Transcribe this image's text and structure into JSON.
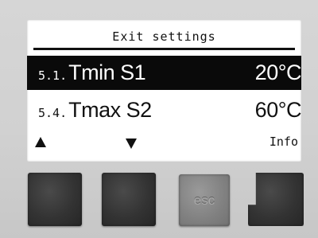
{
  "screen": {
    "title": "Exit settings",
    "rows": [
      {
        "index": "5.1.",
        "name": "Tmin S1",
        "value": "20°C",
        "selected": true
      },
      {
        "index": "5.4.",
        "name": "Tmax S2",
        "value": "60°C",
        "selected": false
      }
    ],
    "softkeys": {
      "left": "up-arrow-icon",
      "middle": "down-arrow-icon",
      "right_label": "Info"
    }
  },
  "buttons": {
    "esc_label": "esc"
  },
  "colors": {
    "lcd_background": "#ffffff",
    "lcd_text": "#111111",
    "selection_background": "#0a0a0a",
    "panel": "#d3d3d3",
    "button_dark": "#333333",
    "button_esc": "#808080"
  }
}
